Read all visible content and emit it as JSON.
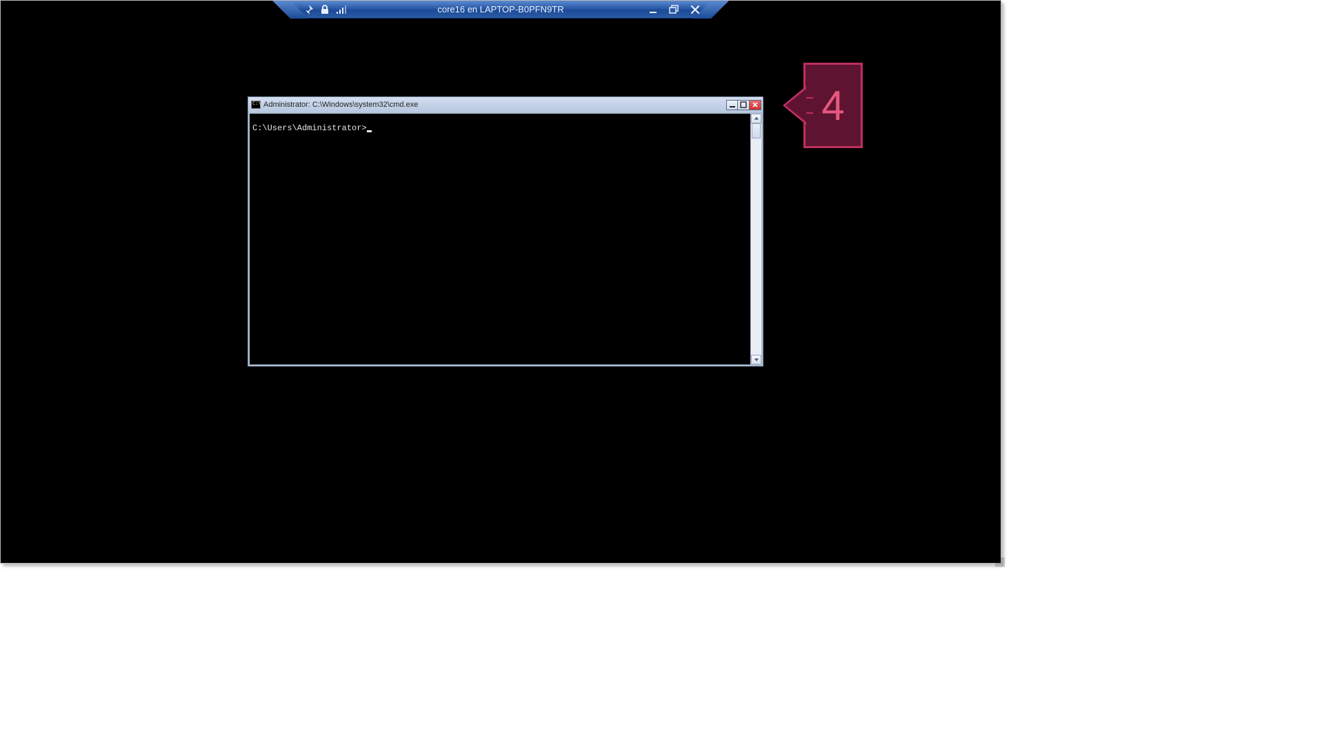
{
  "connection_bar": {
    "title": "core16 en LAPTOP-B0PFN9TR",
    "icons": {
      "pin": "pin-icon",
      "lock": "lock-icon",
      "signal": "signal-icon"
    },
    "controls": {
      "minimize": "minimize",
      "restore": "restore",
      "close": "close"
    }
  },
  "cmd_window": {
    "title": "Administrator: C:\\Windows\\system32\\cmd.exe",
    "prompt": "C:\\Users\\Administrator>",
    "controls": {
      "minimize": "minimize",
      "maximize": "maximize",
      "close": "close"
    },
    "scrollbar": {
      "up": "scroll-up",
      "down": "scroll-down"
    }
  },
  "callout": {
    "number": "4"
  }
}
